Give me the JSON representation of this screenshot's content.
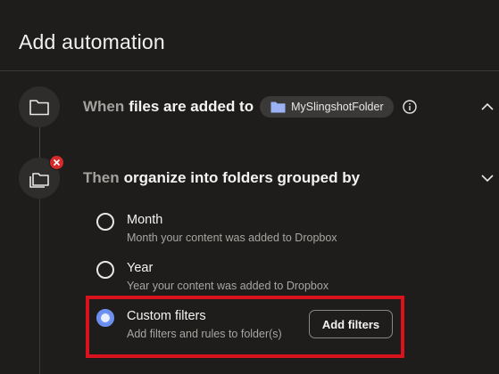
{
  "header": {
    "title": "Add automation"
  },
  "trigger": {
    "prefix": "When",
    "text": "files are added to",
    "folder_name": "MySlingshotFolder",
    "folder_icon": "folder-icon",
    "info_icon": "info-icon",
    "chevron": "chevron-up-icon"
  },
  "action": {
    "prefix": "Then",
    "text": "organize into folders grouped by",
    "badge_icon": "remove-x-icon",
    "chevron": "chevron-down-icon"
  },
  "options": [
    {
      "label": "Month",
      "description": "Month your content was added to Dropbox",
      "selected": false
    },
    {
      "label": "Year",
      "description": "Year your content was added to Dropbox",
      "selected": false
    },
    {
      "label": "Custom filters",
      "description": "Add filters and rules to folder(s)",
      "selected": true
    }
  ],
  "buttons": {
    "add_filters": "Add filters"
  },
  "colors": {
    "accent": "#6f93f5",
    "highlight": "#d9121e",
    "badge": "#d52b2b",
    "background": "#1e1d1c"
  }
}
